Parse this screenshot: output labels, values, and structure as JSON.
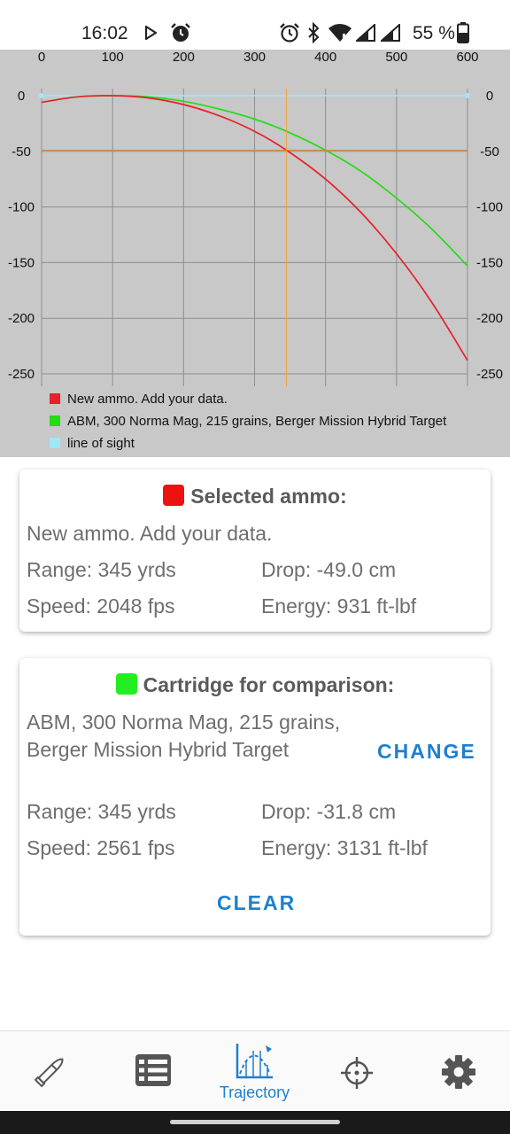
{
  "status_bar": {
    "time": "16:02",
    "battery": "55 %",
    "left_icons": [
      "play-store-icon",
      "alarm-icon"
    ],
    "right_icons": [
      "alarm-icon",
      "bluetooth-icon",
      "wifi-icon",
      "signal-icon",
      "signal-icon",
      "battery-icon"
    ]
  },
  "chart_data": {
    "type": "line",
    "x": [
      0,
      50,
      100,
      150,
      200,
      250,
      300,
      345,
      400,
      450,
      500,
      550,
      600
    ],
    "xlim": [
      0,
      600
    ],
    "ylim": [
      -250,
      0
    ],
    "x_ticks": [
      0,
      100,
      200,
      300,
      400,
      500,
      600
    ],
    "y_ticks": [
      0,
      -50,
      -100,
      -150,
      -200,
      -250
    ],
    "grid": true,
    "marker_x": 345,
    "marker_y": -49,
    "series": [
      {
        "name": "New ammo. Add your data.",
        "color": "#e8202a",
        "values": [
          -6,
          -1,
          0,
          -2,
          -8,
          -18,
          -32,
          -49,
          -75,
          -105,
          -142,
          -186,
          -238
        ]
      },
      {
        "name": "ABM, 300 Norma Mag, 215 grains, Berger Mission Hybrid Target",
        "color": "#22dd11",
        "values": [
          -6,
          -1,
          0,
          -1,
          -5,
          -12,
          -21,
          -32,
          -49,
          -68,
          -92,
          -120,
          -153
        ]
      },
      {
        "name": "line of sight",
        "color": "#9fe8f5",
        "values": [
          0,
          0,
          0,
          0,
          0,
          0,
          0,
          0,
          0,
          0,
          0,
          0,
          0
        ]
      }
    ]
  },
  "selected": {
    "title": "Selected ammo:",
    "color": "#ee1111",
    "name": "New ammo. Add your data.",
    "range": "Range: 345 yrds",
    "drop": "Drop: -49.0 cm",
    "speed": "Speed: 2048 fps",
    "energy": "Energy: 931 ft-lbf"
  },
  "comparison": {
    "title": "Cartridge for comparison:",
    "color": "#22ee22",
    "name": "ABM, 300 Norma Mag, 215 grains, Berger Mission Hybrid Target",
    "change_label": "CHANGE",
    "range": "Range: 345 yrds",
    "drop": "Drop: -31.8 cm",
    "speed": "Speed: 2561 fps",
    "energy": "Energy: 3131 ft-lbf",
    "clear_label": "CLEAR"
  },
  "bottom_nav": {
    "accent": "#1e7fd0",
    "items": [
      {
        "icon": "cartridge-icon",
        "label": ""
      },
      {
        "icon": "list-icon",
        "label": ""
      },
      {
        "icon": "trajectory-icon",
        "label": "Trajectory",
        "active": true
      },
      {
        "icon": "crosshair-icon",
        "label": ""
      },
      {
        "icon": "settings-gear-icon",
        "label": ""
      }
    ]
  }
}
